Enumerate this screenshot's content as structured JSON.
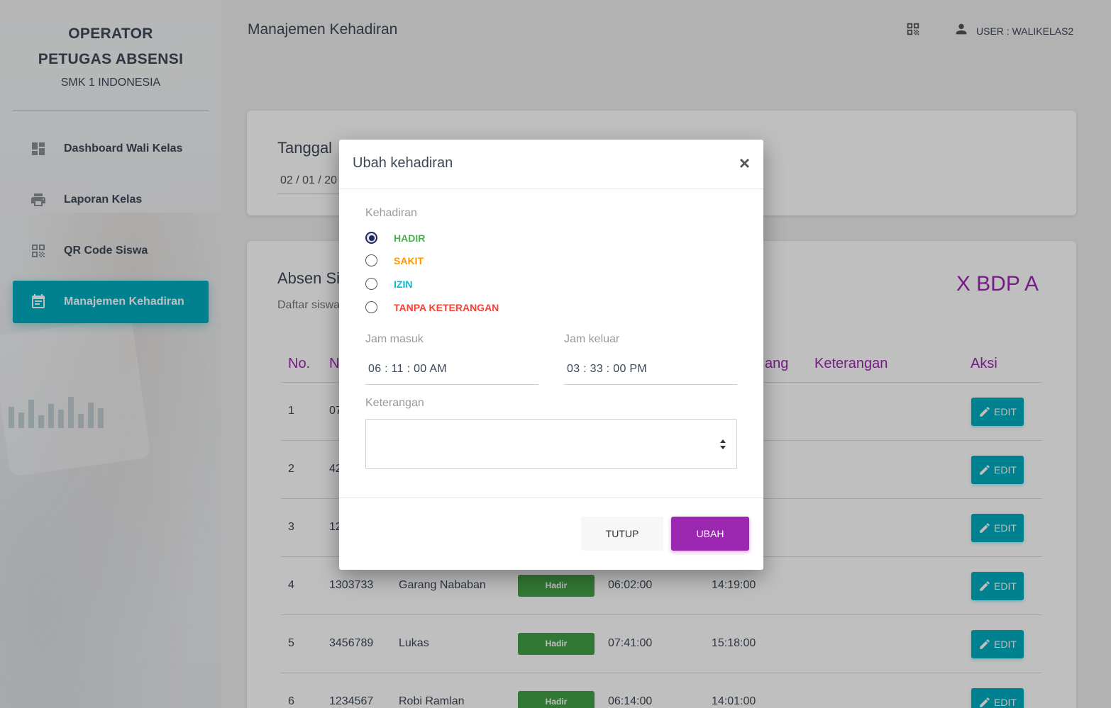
{
  "sidebar": {
    "title_line1": "OPERATOR",
    "title_line2": "PETUGAS ABSENSI",
    "school": "SMK 1 INDONESIA",
    "items": [
      {
        "label": "Dashboard Wali Kelas",
        "icon": "dashboard-icon",
        "active": false
      },
      {
        "label": "Laporan Kelas",
        "icon": "printer-icon",
        "active": false
      },
      {
        "label": "QR Code Siswa",
        "icon": "qr-code-icon",
        "active": false
      },
      {
        "label": "Manajemen Kehadiran",
        "icon": "calendar-icon",
        "active": true
      }
    ]
  },
  "header": {
    "page_title": "Manajemen Kehadiran",
    "user_label": "USER : WALIKELAS2"
  },
  "date_card": {
    "label": "Tanggal",
    "date_value": "02 / 01 / 20"
  },
  "attendance_card": {
    "title": "Absen Sis",
    "subtitle": "Daftar siswa",
    "class_name": "X BDP A",
    "columns": [
      "No.",
      "N",
      "ang",
      "Keterangan",
      "Aksi"
    ],
    "edit_label": "EDIT",
    "rows": [
      {
        "no": "1",
        "nis": "07",
        "name": "",
        "status": "",
        "in": "",
        "out": ""
      },
      {
        "no": "2",
        "nis": "42",
        "name": "",
        "status": "",
        "in": "",
        "out": ""
      },
      {
        "no": "3",
        "nis": "12",
        "name": "",
        "status": "",
        "in": "",
        "out": ""
      },
      {
        "no": "4",
        "nis": "1303733",
        "name": "Garang Nababan",
        "status": "Hadir",
        "in": "06:02:00",
        "out": "14:19:00"
      },
      {
        "no": "5",
        "nis": "3456789",
        "name": "Lukas",
        "status": "Hadir",
        "in": "07:41:00",
        "out": "15:18:00"
      },
      {
        "no": "6",
        "nis": "1234567",
        "name": "Robi Ramlan",
        "status": "Hadir",
        "in": "06:14:00",
        "out": "14:01:00"
      }
    ]
  },
  "modal": {
    "title": "Ubah kehadiran",
    "close_symbol": "×",
    "kehadiran_label": "Kehadiran",
    "options": [
      {
        "label": "HADIR",
        "color": "#4caf50",
        "checked": true
      },
      {
        "label": "SAKIT",
        "color": "#ff9800",
        "checked": false
      },
      {
        "label": "IZIN",
        "color": "#00bcd4",
        "checked": false
      },
      {
        "label": "TANPA KETERANGAN",
        "color": "#f44336",
        "checked": false
      }
    ],
    "jam_masuk_label": "Jam masuk",
    "jam_masuk_value": "06 : 11 : 00   AM",
    "jam_keluar_label": "Jam keluar",
    "jam_keluar_value": "03 : 33 : 00   PM",
    "keterangan_label": "Keterangan",
    "keterangan_value": "",
    "btn_tutup": "TUTUP",
    "btn_ubah": "UBAH"
  },
  "colors": {
    "accent": "#00acc1",
    "primary": "#9c27b0",
    "success": "#43a047"
  }
}
